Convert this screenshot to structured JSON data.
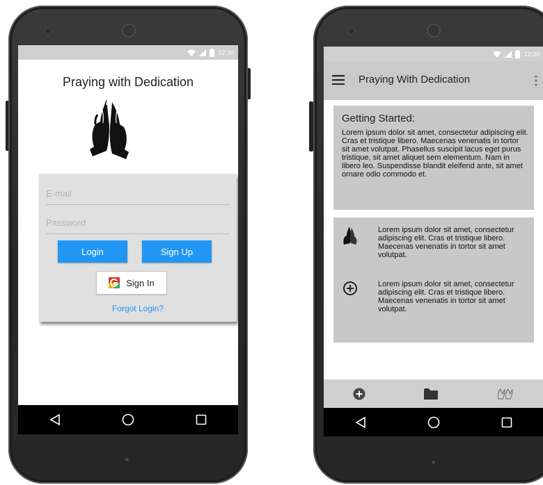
{
  "left_phone": {
    "app_title": "Praying with Dedication",
    "email": {
      "placeholder": "E-mail",
      "value": ""
    },
    "password": {
      "placeholder": "Password",
      "value": ""
    },
    "login_label": "Login",
    "signup_label": "Sign Up",
    "google_signin_label": "Sign In",
    "forgot_label": "Forgot Login?",
    "status_time": "12:30",
    "nav": {
      "back": "back-triangle",
      "home": "home-circle",
      "recents": "recents-square"
    }
  },
  "right_phone": {
    "toolbar_title": "Praying With Dedication",
    "status_time": "12:30",
    "getting_started": {
      "title": "Getting Started:",
      "body": "Lorem ipsum dolor sit amet, consectetur adipiscing elit. Cras et tristique libero. Maecenas venenatis in tortor sit amet volutpat. Phasellus suscipit lacus eget purus tristique, sit amet aliquet sem elementum. Nam in libero leo. Suspendisse blandit eleifend ante, sit amet ornare odio commodo et."
    },
    "features": [
      {
        "icon": "praying-hands-icon",
        "text": "Lorem ipsum dolor sit amet, consectetur adipiscing elit. Cras et tristique libero. Maecenas venenatis in tortor sit amet volutpat."
      },
      {
        "icon": "add-circle-icon",
        "text": "Lorem ipsum dolor sit amet, consectetur adipiscing elit. Cras et tristique libero. Maecenas venenatis in tortor sit amet volutpat."
      }
    ],
    "bottom_nav": [
      "add-circle-filled-icon",
      "folder-icon",
      "hands-outline-icon"
    ]
  },
  "colors": {
    "accent": "#2196f3",
    "card": "#c8c8c8",
    "toolbar": "#cacaca",
    "status": "#cfcfcf"
  }
}
